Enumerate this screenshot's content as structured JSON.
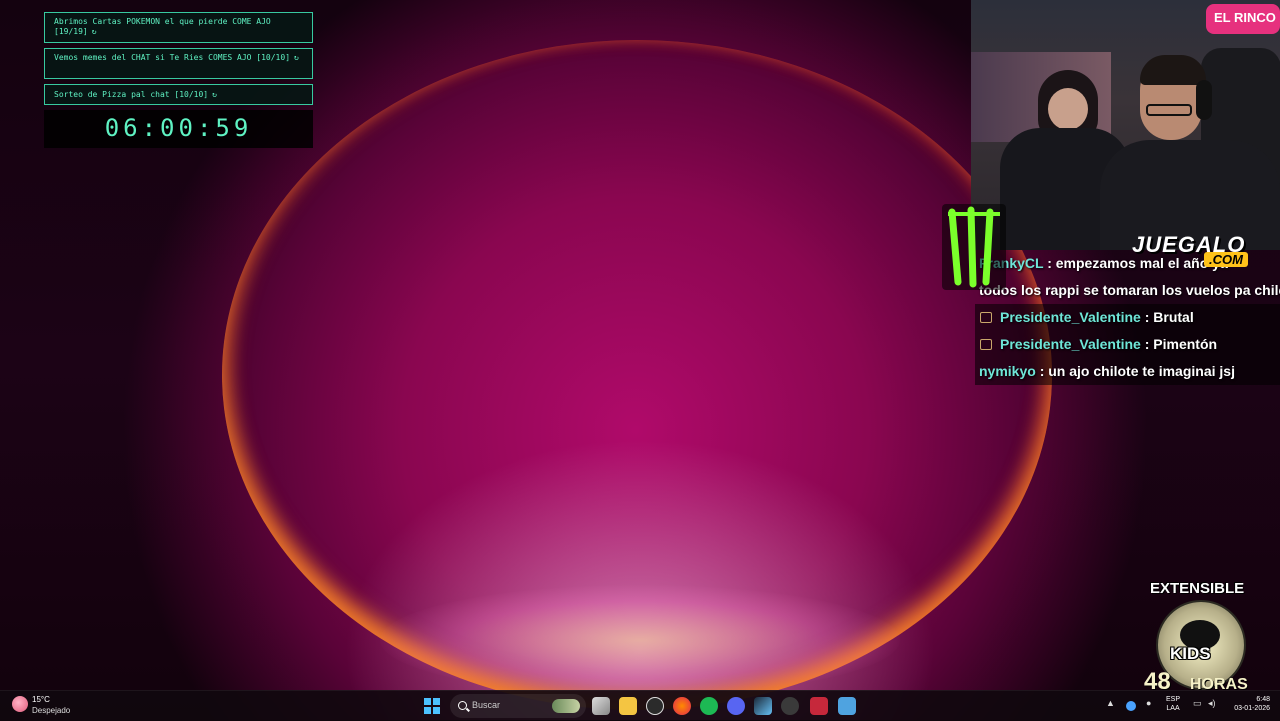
{
  "goals": {
    "items": [
      {
        "text": "Abrimos Cartas POKEMON el que pierde COME AJO [19/19]",
        "mark": "↻"
      },
      {
        "text": "Vemos memes del CHAT si Te Ries COMES AJO [10/10]",
        "mark": "↻"
      },
      {
        "text": "Sorteo de Pizza pal chat [10/10]",
        "mark": "↻"
      }
    ],
    "timer": "06:00:59"
  },
  "webcam": {
    "sign": "EL RINCO",
    "sponsor_name": "JUEGALO",
    "sponsor_suffix": ".COM"
  },
  "chat": {
    "messages": [
      {
        "user": "FrankyCL",
        "text": " : empezamos mal el año ya",
        "badge": false
      },
      {
        "user": "",
        "text": "todos los rappi se tomaran los vuelos pa chile",
        "badge": false
      },
      {
        "user": "Presidente_Valentine",
        "text": " : Brutal",
        "badge": true
      },
      {
        "user": "Presidente_Valentine",
        "text": " : Pimentón",
        "badge": true
      },
      {
        "user": "nymikyo",
        "text": " : un ajo chilote te imaginai jsj",
        "badge": false
      }
    ]
  },
  "extensible": {
    "title": "EXTENSIBLE",
    "kids": "KIDS",
    "hours": "48",
    "hours_label": "HORAS"
  },
  "taskbar": {
    "weather_temp": "15°C",
    "weather_desc": "Despejado",
    "search_label": "Buscar",
    "apps": [
      "task-view-icon",
      "file-explorer-icon",
      "obs-icon",
      "firefox-icon",
      "spotify-icon",
      "discord-icon",
      "steam-icon",
      "app-icon",
      "streamlabs-icon",
      "notepad-icon"
    ],
    "tray_lang_1": "ESP",
    "tray_lang_2": "LAA",
    "time": "6:48",
    "date": "03-01-2026"
  },
  "colors": {
    "goal_accent": "#38c9a0",
    "chat_user": "#6fe6d8",
    "windows_blue": "#4cc2ff"
  }
}
